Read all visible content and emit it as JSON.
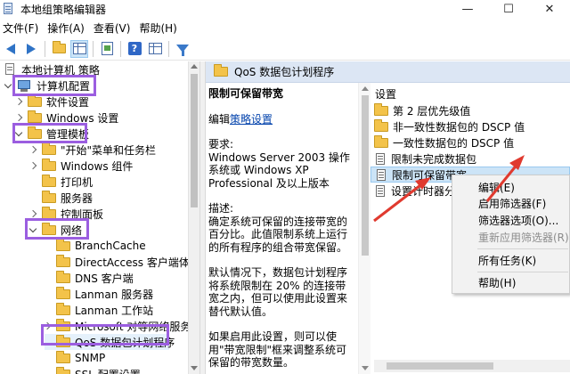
{
  "window": {
    "title": "本地组策略编辑器",
    "minimize": "—",
    "maximize": "☐",
    "close": "✕"
  },
  "menu": [
    "文件(F)",
    "操作(A)",
    "查看(V)",
    "帮助(H)"
  ],
  "toolbar": {
    "icons": [
      "back-arrow-icon",
      "forward-arrow-icon",
      "folder-icon",
      "show-hide-tree-icon",
      "export-list-icon",
      "help-icon",
      "properties-icon",
      "filter-icon"
    ]
  },
  "tree": {
    "root": "本地计算机 策略",
    "computer_config": "计算机配置",
    "software_settings": "软件设置",
    "windows_settings": "Windows 设置",
    "admin_templates": "管理模板",
    "start_menu": "\"开始\"菜单和任务栏",
    "windows_components": "Windows 组件",
    "printers": "打印机",
    "server": "服务器",
    "control_panel": "控制面板",
    "network": "网络",
    "branchcache": "BranchCache",
    "directaccess": "DirectAccess 客户端体验设",
    "dns_client": "DNS 客户端",
    "lanman_server": "Lanman 服务器",
    "lanman_workstation": "Lanman 工作站",
    "microsoft_mapper": "Microsoft 对等网络服务",
    "qos": "QoS 数据包计划程序",
    "snmp": "SNMP",
    "ssl": "SSL 配置设置"
  },
  "right_header": "QoS 数据包计划程序",
  "description": {
    "heading": "限制可保留带宽",
    "edit_prefix": "编辑",
    "edit_link": "策略设置",
    "requirement_label": "要求:",
    "requirement_text": "Windows Server 2003 操作系统或 Windows XP Professional 及以上版本",
    "desc_label": "描述:",
    "desc_text": "确定系统可保留的连接带宽的百分比。此值限制系统上运行的所有程序的组合带宽保留。",
    "default_text": "默认情况下，数据包计划程序将系统限制在 20% 的连接带宽之内，但可以使用此设置来替代默认值。",
    "enable_text": "如果启用此设置，则可以使用\"带宽限制\"框来调整系统可保留的带宽数量。"
  },
  "settings": {
    "header": "设置",
    "items": [
      {
        "label": "第 2 层优先级值",
        "type": "folder"
      },
      {
        "label": "非一致性数据包的 DSCP 值",
        "type": "folder"
      },
      {
        "label": "一致性数据包的 DSCP 值",
        "type": "folder"
      },
      {
        "label": "限制未完成数据包",
        "type": "policy"
      },
      {
        "label": "限制可保留带宽",
        "type": "policy"
      },
      {
        "label": "设置计时器分辨",
        "type": "policy"
      }
    ]
  },
  "context_menu": {
    "items": [
      {
        "label": "编辑(E)",
        "enabled": true
      },
      {
        "label": "启用筛选器(F)",
        "enabled": true
      },
      {
        "label": "筛选器选项(O)...",
        "enabled": true
      },
      {
        "label": "重新应用筛选器(R)",
        "enabled": false
      },
      {
        "label": "所有任务(K)",
        "enabled": true
      },
      {
        "label": "帮助(H)",
        "enabled": true
      }
    ]
  },
  "colors": {
    "highlight_box": "#9b5ee0",
    "annotation_arrow": "#e03a2f",
    "selection": "#cce4f7",
    "header_bar": "#dce6f4"
  }
}
